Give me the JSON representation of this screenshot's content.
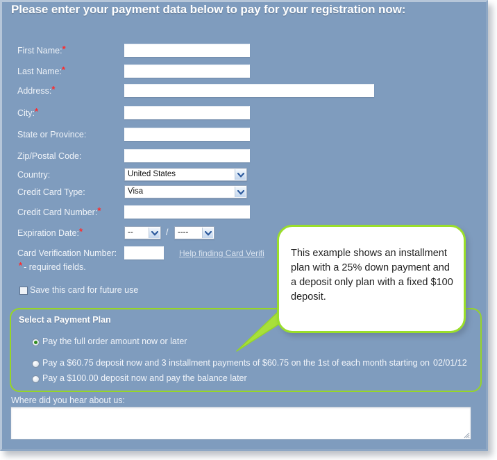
{
  "header": {
    "title": "Please enter your payment data below to pay for your registration now:"
  },
  "form": {
    "fields": [
      {
        "label": "First Name:",
        "required": true,
        "type": "text",
        "value": ""
      },
      {
        "label": "Last Name:",
        "required": true,
        "type": "text",
        "value": ""
      },
      {
        "label": "Address:",
        "required": true,
        "type": "text",
        "value": ""
      },
      {
        "label": "City:",
        "required": true,
        "type": "text",
        "value": ""
      },
      {
        "label": "State or Province:",
        "required": false,
        "type": "text",
        "value": ""
      },
      {
        "label": "Zip/Postal Code:",
        "required": false,
        "type": "text",
        "value": ""
      },
      {
        "label": "Country:",
        "required": false,
        "type": "select",
        "value": "United States"
      },
      {
        "label": "Credit Card Type:",
        "required": false,
        "type": "select",
        "value": "Visa"
      },
      {
        "label": "Credit Card Number:",
        "required": true,
        "type": "text",
        "value": ""
      },
      {
        "label": "Expiration Date:",
        "required": true,
        "type": "date",
        "value": ""
      },
      {
        "label": "Card Verification Number:",
        "required": false,
        "type": "text",
        "value": ""
      }
    ],
    "expiration": {
      "month_value": "--",
      "year_value": "----",
      "separator": "/"
    },
    "help_link_label": "Help finding Card Verifi",
    "required_star": "*",
    "required_note": "- required fields.",
    "save_card_label": "Save this card for future use",
    "save_card_checked": false
  },
  "payment_plan": {
    "title": "Select a Payment Plan",
    "options": [
      {
        "label": "Pay the full order amount now or later",
        "selected": true,
        "date": ""
      },
      {
        "label": "Pay a $60.75 deposit now and 3 installment payments of $60.75 on the 1st of each month starting on",
        "selected": false,
        "date": "02/01/12"
      },
      {
        "label": "Pay a $100.00 deposit now and pay the balance later",
        "selected": false,
        "date": ""
      }
    ]
  },
  "hear_about": {
    "label": "Where did you hear about us:",
    "value": "",
    "placeholder": ""
  },
  "callout": {
    "text": "This example shows an installment plan with a 25% down payment and a deposit only plan with a fixed $100 deposit."
  },
  "colors": {
    "background": "#7f9cbe",
    "accent_green": "#96d528",
    "required_red": "#ff2b2b",
    "text_light": "#f0f4f9",
    "callout_text": "#222222"
  }
}
